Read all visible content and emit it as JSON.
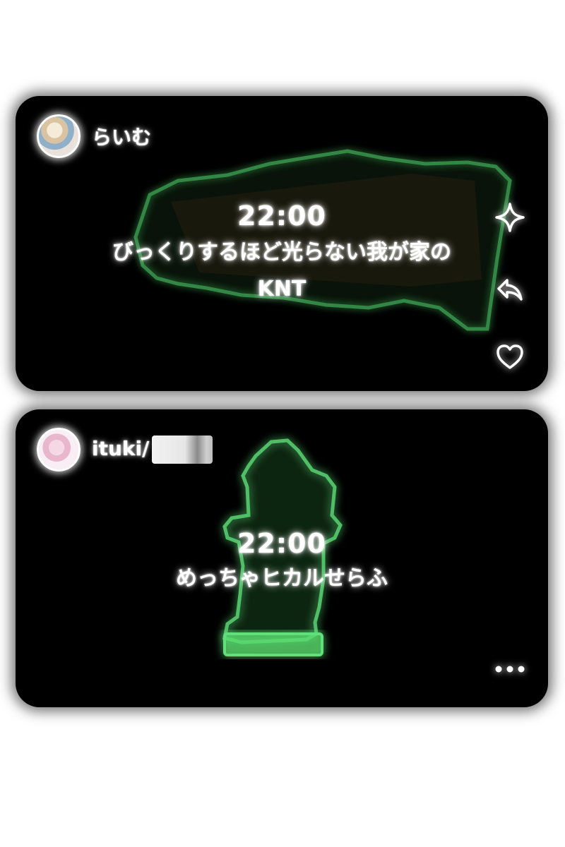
{
  "posts": [
    {
      "author": "らいむ",
      "avatar_icon": "profile-photo-icon",
      "time": "22:00",
      "caption_line1": "びっくりするほど光らない我が家の",
      "caption_line2": "KNT",
      "actions": [
        "sparkle-icon",
        "reply-arrow-icon",
        "heart-icon"
      ]
    },
    {
      "author": "ituki/",
      "avatar_icon": "profile-photo-icon",
      "time": "22:00",
      "caption_line1": "めっちゃヒカルせらふ",
      "actions": [
        "more-dots-icon"
      ]
    }
  ],
  "colors": {
    "card_background": "#000000",
    "page_background": "#ffffff",
    "glow_green": "#5fe07a",
    "text": "#ffffff"
  }
}
